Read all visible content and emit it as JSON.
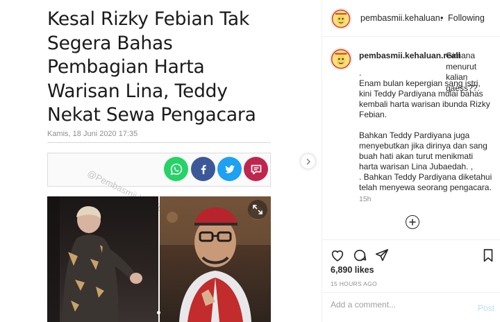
{
  "article": {
    "headline_lines": [
      "Kesal Rizky Febian Tak",
      "Segera Bahas",
      "Pembagian Harta",
      "Warisan Lina, Teddy",
      "Nekat Sewa Pengacara"
    ],
    "date": "Kamis, 18 Juni 2020 17:35",
    "watermark": "@Pembasmii.kehaluan.real"
  },
  "share_icons": [
    "whatsapp-icon",
    "facebook-icon",
    "twitter-icon",
    "comment-icon"
  ],
  "header": {
    "username": "pembasmii.kehaluan.",
    "separator": "•",
    "follow_state": "Following"
  },
  "caption": {
    "username": "pembasmii.kehaluan.reall",
    "first_line": "Gimana menurut kalian gaess??.",
    "lines": [
      ".",
      "Enam bulan kepergian sang istri,",
      "kini Teddy Pardiyana mulai bahas",
      "kembali harta warisan ibunda Rizky",
      "Febian.",
      "",
      "Bahkan Teddy Pardiyana juga",
      "menyebutkan jika dirinya dan sang",
      "buah hati akan turut menikmati",
      "harta warisan Lina Jubaedah. ,",
      ". Bahkan Teddy Pardiyana diketahui",
      "telah menyewa seorang pengacara."
    ],
    "time": "15h"
  },
  "actions": {
    "icons": [
      "heart-icon",
      "comment-icon",
      "share-icon",
      "bookmark-icon"
    ],
    "likes": "6,890 likes",
    "posted": "15 HOURS AGO"
  },
  "comment_box": {
    "placeholder": "Add a comment...",
    "post_label": "Post"
  },
  "colors": {
    "whatsapp": "#25d366",
    "facebook": "#3b5998",
    "twitter": "#1da1f2",
    "comment": "#c0254f",
    "post_button": "#b2dffc"
  }
}
